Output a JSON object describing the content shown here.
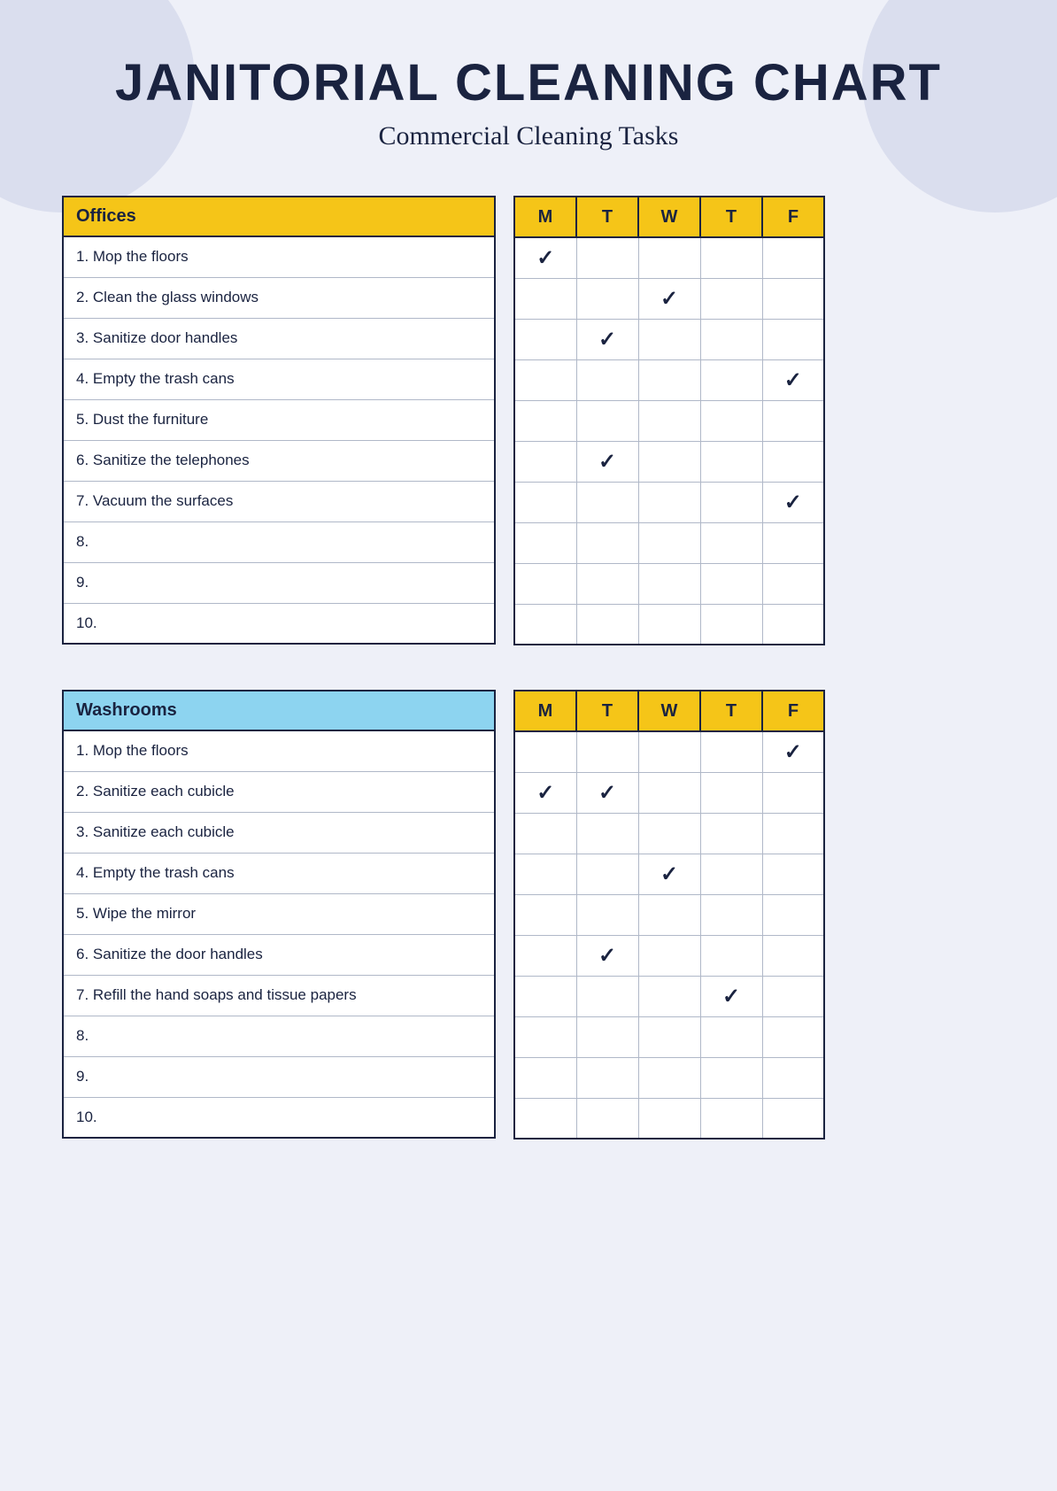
{
  "title": "JANITORIAL CLEANING CHART",
  "subtitle": "Commercial Cleaning Tasks",
  "sections": [
    {
      "id": "offices",
      "header": "Offices",
      "header_class": "offices-header",
      "tasks": [
        "1. Mop the floors",
        "2. Clean the glass windows",
        "3. Sanitize door handles",
        "4. Empty the trash cans",
        "5. Dust the furniture",
        "6. Sanitize the telephones",
        "7. Vacuum the surfaces",
        "8.",
        "9.",
        "10."
      ],
      "days": [
        "M",
        "T",
        "W",
        "T",
        "F"
      ],
      "checks": [
        [
          true,
          false,
          false,
          false,
          false
        ],
        [
          false,
          false,
          true,
          false,
          false
        ],
        [
          false,
          true,
          false,
          false,
          false
        ],
        [
          false,
          false,
          false,
          false,
          true
        ],
        [
          false,
          false,
          false,
          false,
          false
        ],
        [
          false,
          true,
          false,
          false,
          false
        ],
        [
          false,
          false,
          false,
          false,
          true
        ],
        [
          false,
          false,
          false,
          false,
          false
        ],
        [
          false,
          false,
          false,
          false,
          false
        ],
        [
          false,
          false,
          false,
          false,
          false
        ]
      ]
    },
    {
      "id": "washrooms",
      "header": "Washrooms",
      "header_class": "washrooms-header",
      "tasks": [
        "1. Mop the floors",
        "2. Sanitize each cubicle",
        "3. Sanitize each cubicle",
        "4. Empty the trash cans",
        "5. Wipe the mirror",
        "6. Sanitize the door handles",
        "7. Refill the hand soaps and tissue papers",
        "8.",
        "9.",
        "10."
      ],
      "days": [
        "M",
        "T",
        "W",
        "T",
        "F"
      ],
      "checks": [
        [
          false,
          false,
          false,
          false,
          true
        ],
        [
          true,
          true,
          false,
          false,
          false
        ],
        [
          false,
          false,
          false,
          false,
          false
        ],
        [
          false,
          false,
          true,
          false,
          false
        ],
        [
          false,
          false,
          false,
          false,
          false
        ],
        [
          false,
          true,
          false,
          false,
          false
        ],
        [
          false,
          false,
          false,
          true,
          false
        ],
        [
          false,
          false,
          false,
          false,
          false
        ],
        [
          false,
          false,
          false,
          false,
          false
        ],
        [
          false,
          false,
          false,
          false,
          false
        ]
      ]
    }
  ]
}
